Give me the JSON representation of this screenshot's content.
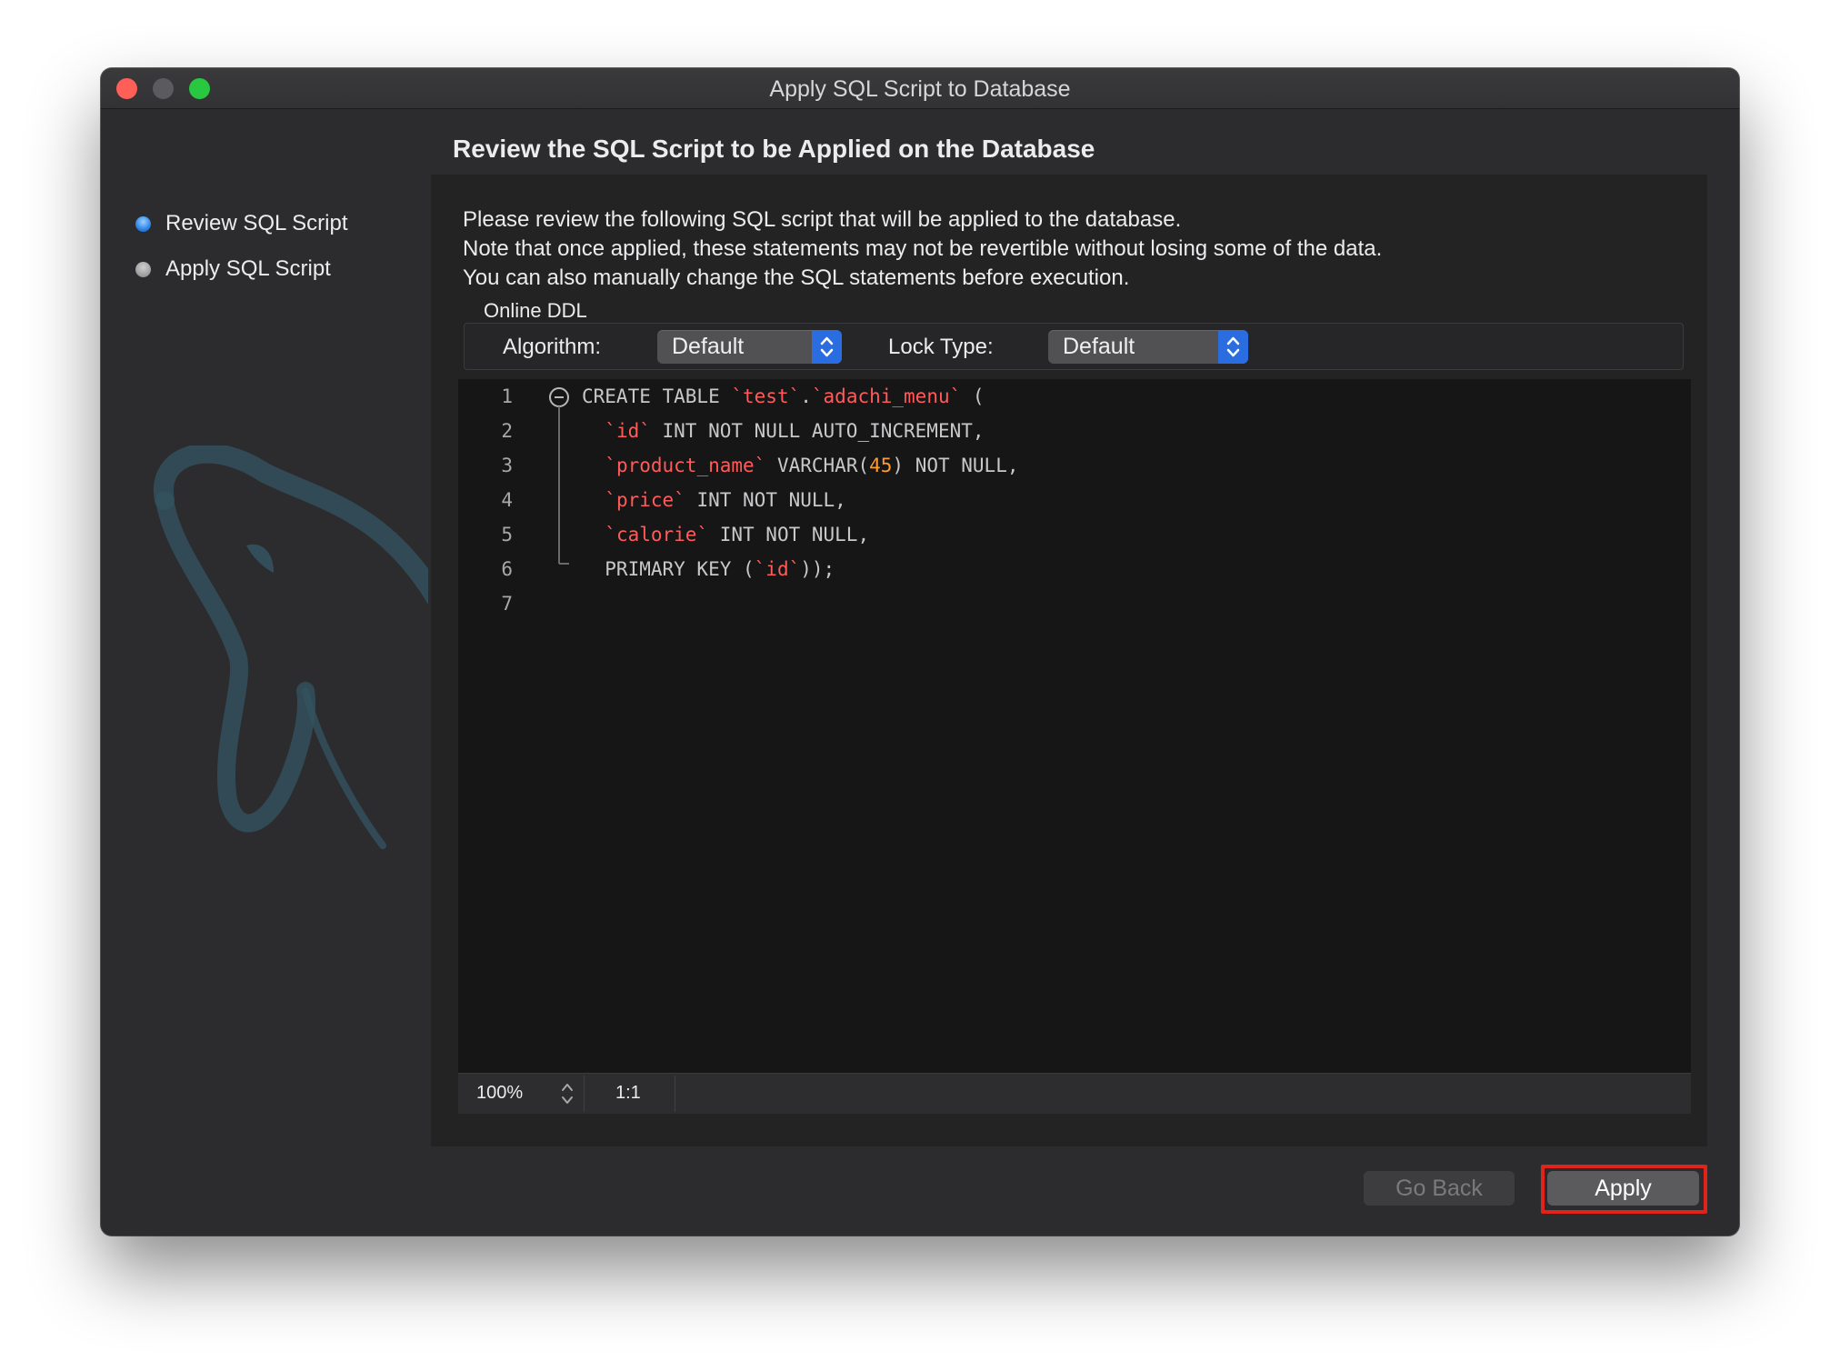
{
  "window": {
    "title": "Apply SQL Script to Database"
  },
  "sidebar": {
    "steps": [
      {
        "label": "Review SQL Script",
        "state": "active"
      },
      {
        "label": "Apply SQL Script",
        "state": "pending"
      }
    ]
  },
  "main": {
    "heading": "Review the SQL Script to be Applied on the Database",
    "description": [
      "Please review the following SQL script that will be applied to the database.",
      "Note that once applied, these statements may not be revertible without losing some of the data.",
      "You can also manually change the SQL statements before execution."
    ],
    "online_ddl": {
      "group_label": "Online DDL",
      "algorithm_label": "Algorithm:",
      "algorithm_value": "Default",
      "lock_type_label": "Lock Type:",
      "lock_type_value": "Default"
    }
  },
  "editor": {
    "lines": [
      {
        "num": "1",
        "parts": [
          [
            "kw",
            "CREATE TABLE "
          ],
          [
            "ident",
            "`test`"
          ],
          [
            "kw",
            "."
          ],
          [
            "ident",
            "`adachi_menu`"
          ],
          [
            "kw",
            " ("
          ]
        ]
      },
      {
        "num": "2",
        "parts": [
          [
            "kw",
            "  "
          ],
          [
            "ident",
            "`id`"
          ],
          [
            "kw",
            " INT NOT NULL AUTO_INCREMENT,"
          ]
        ]
      },
      {
        "num": "3",
        "parts": [
          [
            "kw",
            "  "
          ],
          [
            "ident",
            "`product_name`"
          ],
          [
            "kw",
            " VARCHAR("
          ],
          [
            "num",
            "45"
          ],
          [
            "kw",
            ") NOT NULL,"
          ]
        ]
      },
      {
        "num": "4",
        "parts": [
          [
            "kw",
            "  "
          ],
          [
            "ident",
            "`price`"
          ],
          [
            "kw",
            " INT NOT NULL,"
          ]
        ]
      },
      {
        "num": "5",
        "parts": [
          [
            "kw",
            "  "
          ],
          [
            "ident",
            "`calorie`"
          ],
          [
            "kw",
            " INT NOT NULL,"
          ]
        ]
      },
      {
        "num": "6",
        "parts": [
          [
            "kw",
            "  PRIMARY KEY ("
          ],
          [
            "ident",
            "`id`"
          ],
          [
            "kw",
            "));"
          ]
        ]
      },
      {
        "num": "7",
        "parts": []
      }
    ],
    "zoom": "100%",
    "cursor_position": "1:1"
  },
  "buttons": {
    "go_back": "Go Back",
    "apply": "Apply"
  },
  "colors": {
    "window_bg": "#2c2c2e",
    "editor_bg": "#161617",
    "identifier": "#ff5b5b",
    "number": "#ff9b2f",
    "accent": "#2a6de0",
    "highlight_border": "#e0241b"
  }
}
